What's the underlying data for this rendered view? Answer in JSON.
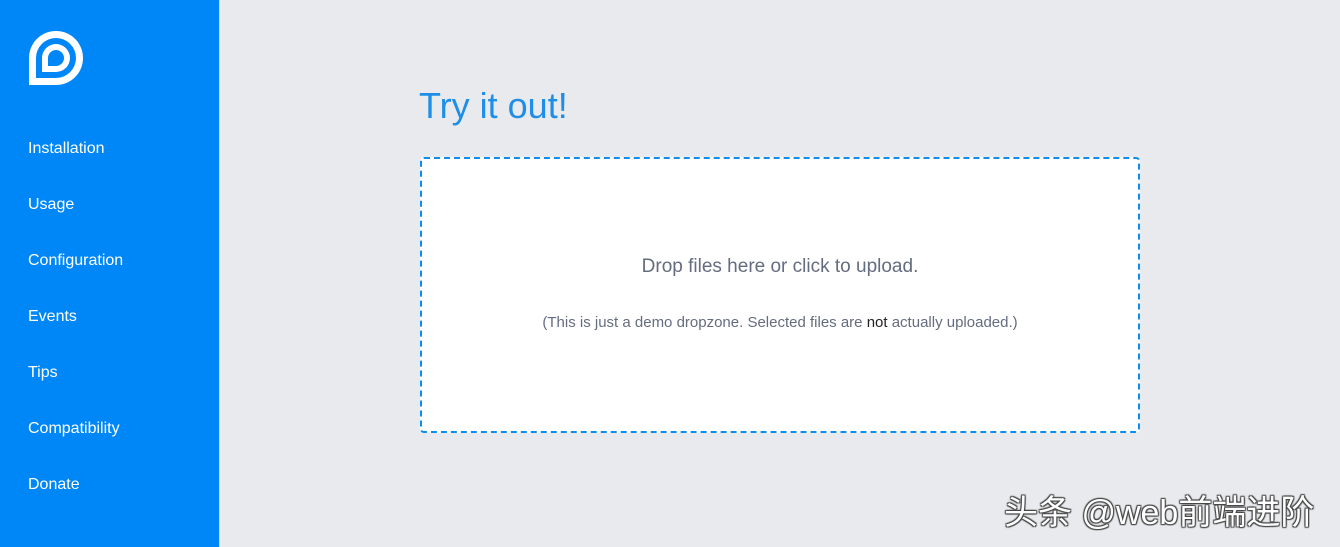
{
  "sidebar": {
    "logo_icon": "dropzone-logo-icon",
    "items": [
      {
        "label": "Installation"
      },
      {
        "label": "Usage"
      },
      {
        "label": "Configuration"
      },
      {
        "label": "Events"
      },
      {
        "label": "Tips"
      },
      {
        "label": "Compatibility"
      },
      {
        "label": "Donate"
      }
    ]
  },
  "main": {
    "title": "Try it out!",
    "dropzone": {
      "message": "Drop files here or click to upload.",
      "note_before": "(This is just a demo dropzone. Selected files are ",
      "note_emphasis": "not",
      "note_after": " actually uploaded.)"
    }
  },
  "watermark": {
    "text": "头条 @web前端进阶"
  },
  "colors": {
    "sidebar_bg": "#0087f7",
    "page_bg": "#e8eaed",
    "title": "#1e8ee8",
    "dropzone_border": "#0a8ef0",
    "dropzone_text": "#646c7f"
  }
}
